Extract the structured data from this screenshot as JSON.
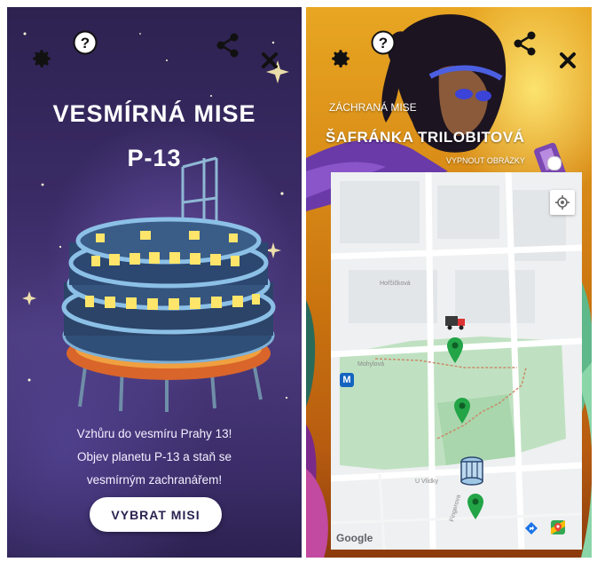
{
  "left": {
    "title_line1": "VESMÍRNÁ MISE",
    "title_line2": "P-13",
    "description_lines": [
      "Vzhůru do vesmíru Prahy 13!",
      "Objev planetu P-13 a staň se",
      "vesmírným zachranářem!"
    ],
    "cta_label": "VYBRAT MISI",
    "icons": [
      "gear-icon",
      "help-icon",
      "share-icon",
      "close-icon"
    ]
  },
  "right": {
    "mission_label": "ZÁCHRANÁ MISE",
    "character_name": "ŠAFRÁNKA TRILOBITOVÁ",
    "toggle_label": "VYPNOUT OBRÁZKY",
    "icons": [
      "gear-icon",
      "help-icon",
      "share-icon",
      "close-icon"
    ],
    "map": {
      "streets": [
        "Hořčičková",
        "Mohylová",
        "U Vlídky",
        "Fingerova"
      ],
      "metro_label": "M",
      "attribution": "Google",
      "controls": [
        "locate-icon",
        "directions-icon",
        "maps-app-icon"
      ]
    }
  },
  "colors": {
    "space_purple": "#3a2b66",
    "sunset_orange": "#d98c17",
    "pin_green": "#22a447",
    "park_green": "#bfe1c1",
    "metro_blue": "#1565c0"
  }
}
